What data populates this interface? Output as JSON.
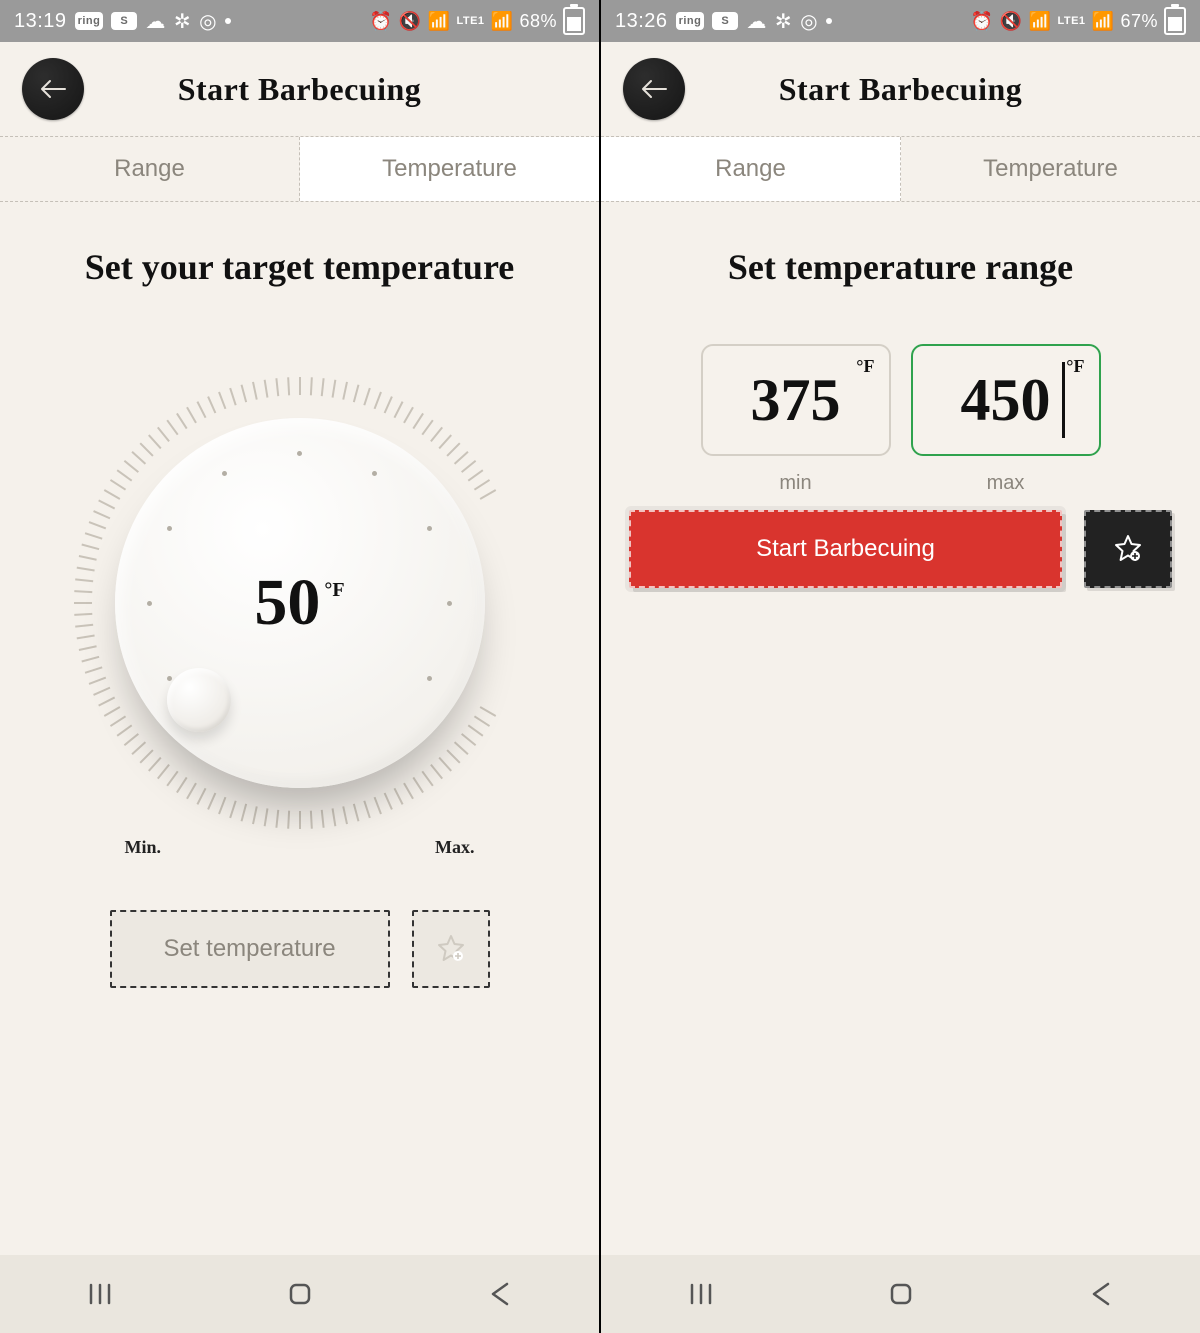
{
  "left": {
    "status": {
      "time": "13:19",
      "lte": "LTE1",
      "battery": "68%"
    },
    "header_title": "Start Barbecuing",
    "tabs": [
      {
        "label": "Range",
        "active": false
      },
      {
        "label": "Temperature",
        "active": true
      }
    ],
    "page_heading": "Set your target temperature",
    "dial": {
      "value": "50",
      "unit": "°F",
      "min_label": "Min.",
      "max_label": "Max."
    },
    "actions": {
      "primary_label": "Set temperature"
    }
  },
  "right": {
    "status": {
      "time": "13:26",
      "lte": "LTE1",
      "battery": "67%"
    },
    "header_title": "Start Barbecuing",
    "tabs": [
      {
        "label": "Range",
        "active": true
      },
      {
        "label": "Temperature",
        "active": false
      }
    ],
    "page_heading": "Set temperature range",
    "range": {
      "min": {
        "value": "375",
        "unit": "°F",
        "label": "min"
      },
      "max": {
        "value": "450",
        "unit": "°F",
        "label": "max"
      }
    },
    "actions": {
      "primary_label": "Start Barbecuing"
    }
  },
  "icons": {
    "star_add": "star-add-icon",
    "back_arrow": "back-arrow-icon"
  }
}
